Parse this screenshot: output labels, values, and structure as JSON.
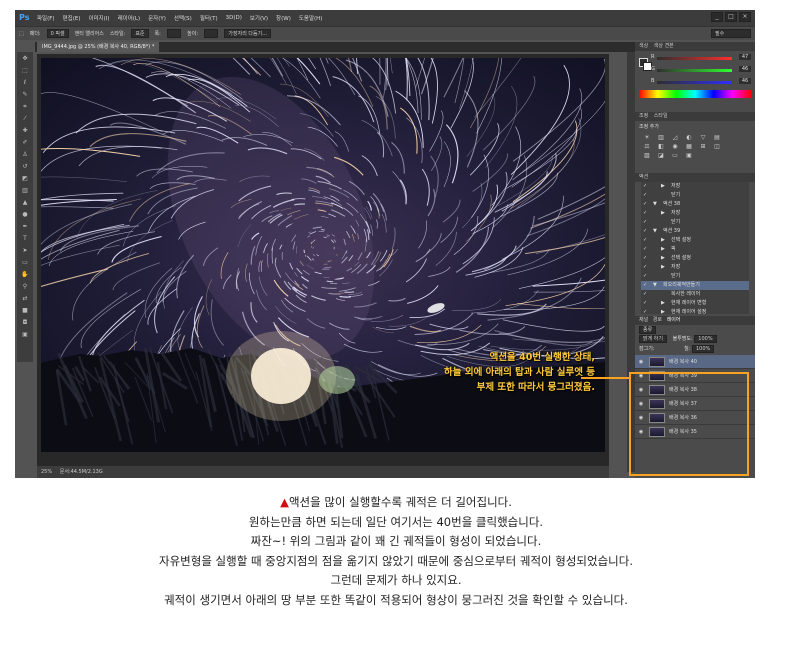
{
  "app": {
    "logo": "Ps",
    "menus": [
      "파일(F)",
      "편집(E)",
      "이미지(I)",
      "레이어(L)",
      "문자(Y)",
      "선택(S)",
      "필터(T)",
      "3D(D)",
      "보기(V)",
      "창(W)",
      "도움말(H)"
    ],
    "window_controls": [
      "_",
      "□",
      "×"
    ],
    "options": {
      "feather_label": "페더:",
      "feather_value": "0 픽셀",
      "antialias": "앤티 앨리어스",
      "style_label": "스타일:",
      "style_value": "표준",
      "width_label": "폭:",
      "height_label": "높이:",
      "refine_edge": "가장자리 다듬기...",
      "workspace": "필수"
    },
    "document_tab": "IMG_9444.jpg @ 25% (배경 복사 40, RGB/8*) *",
    "status": {
      "zoom": "25%",
      "doc": "문서:44.5M/2.13G"
    }
  },
  "panels": {
    "color_tabs": [
      "색상",
      "색상 견본"
    ],
    "color": {
      "r_label": "R",
      "g_label": "G",
      "b_label": "B",
      "r": "47",
      "g": "46",
      "b": "46"
    },
    "adjust_tabs": [
      "조정",
      "스타일"
    ],
    "adjust_title": "조정 추가",
    "actions_tab": "액션",
    "actions": [
      {
        "indent": 2,
        "label": "저장",
        "arrow": "▶"
      },
      {
        "indent": 2,
        "label": "닫기",
        "arrow": ""
      },
      {
        "indent": 1,
        "label": "액션 38",
        "arrow": "▼"
      },
      {
        "indent": 2,
        "label": "저장",
        "arrow": "▶"
      },
      {
        "indent": 2,
        "label": "닫기",
        "arrow": ""
      },
      {
        "indent": 1,
        "label": "액션 39",
        "arrow": "▼"
      },
      {
        "indent": 2,
        "label": "선택 설정",
        "arrow": "▶"
      },
      {
        "indent": 2,
        "label": "픽",
        "arrow": "▶"
      },
      {
        "indent": 2,
        "label": "선택 설정",
        "arrow": "▶"
      },
      {
        "indent": 2,
        "label": "저장",
        "arrow": "▶"
      },
      {
        "indent": 2,
        "label": "닫기",
        "arrow": ""
      },
      {
        "indent": 1,
        "label": "회오리궤적만들기",
        "arrow": "▼",
        "selected": true
      },
      {
        "indent": 2,
        "label": "복사한 레이어",
        "arrow": ""
      },
      {
        "indent": 2,
        "label": "현재 레이어 변형",
        "arrow": "▶"
      },
      {
        "indent": 2,
        "label": "현재 레이어 설정",
        "arrow": "▶"
      }
    ],
    "layers_tabs": [
      "채널",
      "경로",
      "레이어"
    ],
    "layers_kind": "종류",
    "blend_mode": "밝게 하기",
    "opacity_label": "불투명도:",
    "opacity": "100%",
    "lock_label": "잠그기:",
    "fill_label": "칠:",
    "fill": "100%",
    "layers": [
      {
        "name": "배경 복사 40",
        "selected": true
      },
      {
        "name": "배경 복사 39"
      },
      {
        "name": "배경 복사 38"
      },
      {
        "name": "배경 복사 37"
      },
      {
        "name": "배경 복사 36"
      },
      {
        "name": "배경 복사 35"
      }
    ]
  },
  "annotation": {
    "line1": "액션을 40번 실행한 상태,",
    "line2": "하늘 외에 아래의 탑과 사람 실루엣 등",
    "line3": "부제 또한 따라서 뭉그러졌음."
  },
  "caption": {
    "bullet": "▲",
    "lines": [
      "액션을 많이 실행할수록 궤적은 더 길어집니다.",
      "원하는만큼 하면 되는데 일단 여기서는 40번을 클릭했습니다.",
      "짜잔~! 위의 그림과 같이 꽤 긴 궤적들이 형성이 되었습니다.",
      "자유변형을 실행할 때 중앙지점의 점을 옮기지 않았기 때문에 중심으로부터 궤적이 형성되었습니다.",
      "그런데 문제가 하나 있지요.",
      "궤적이 생기면서 아래의 땅 부분 또한 똑같이 적용되어 형상이 뭉그러진 것을 확인할 수 있습니다."
    ]
  }
}
